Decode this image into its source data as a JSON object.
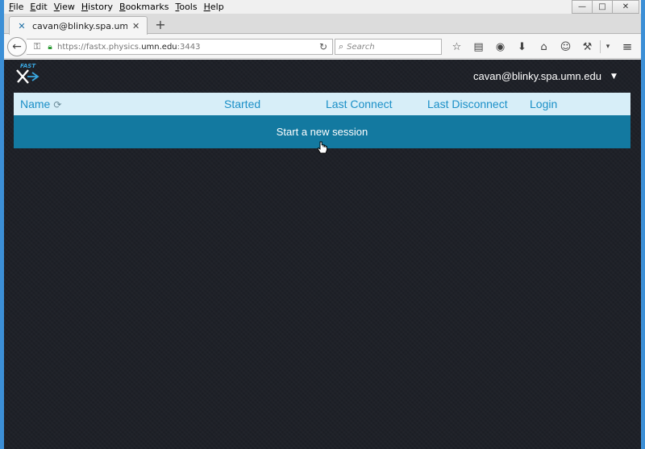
{
  "menubar": {
    "items": [
      {
        "label": "File",
        "key": "F",
        "rest": "ile"
      },
      {
        "label": "Edit",
        "key": "E",
        "rest": "dit"
      },
      {
        "label": "View",
        "key": "V",
        "rest": "iew"
      },
      {
        "label": "History",
        "key": "H",
        "rest": "istory"
      },
      {
        "label": "Bookmarks",
        "key": "B",
        "rest": "ookmarks"
      },
      {
        "label": "Tools",
        "key": "T",
        "rest": "ools"
      },
      {
        "label": "Help",
        "key": "H",
        "rest": "elp"
      }
    ]
  },
  "window_controls": {
    "minimize": "—",
    "maximize": "□",
    "close": "✕"
  },
  "tab": {
    "title": "cavan@blinky.spa.umn.ed...",
    "close": "✕",
    "new_tab": "+"
  },
  "nav": {
    "back": "←",
    "url_prefix": "https://fastx.physics.",
    "url_host": "umn.edu",
    "url_suffix": ":3443",
    "reload": "↻",
    "search_placeholder": "Search"
  },
  "toolbar_icons": [
    {
      "name": "bookmark-star-icon",
      "glyph": "☆"
    },
    {
      "name": "reading-list-icon",
      "glyph": "▤"
    },
    {
      "name": "pocket-icon",
      "glyph": "◉"
    },
    {
      "name": "download-icon",
      "glyph": "⬇"
    },
    {
      "name": "home-icon",
      "glyph": "⌂"
    },
    {
      "name": "chat-icon",
      "glyph": "☺"
    },
    {
      "name": "extension-icon",
      "glyph": "⚒"
    },
    {
      "name": "overflow-caret-icon",
      "glyph": "▾"
    }
  ],
  "hamburger": "≡",
  "app": {
    "user": "cavan@blinky.spa.umn.edu",
    "user_caret": "▼",
    "logo_text": "FAST",
    "columns": [
      "Name",
      "Started",
      "Last Connect",
      "Last Disconnect",
      "Login"
    ],
    "refresh_glyph": "⟳",
    "new_session_label": "Start a new session"
  },
  "colors": {
    "header_bg": "#d7eef8",
    "header_text": "#1a8fc7",
    "new_session_bg": "#1379a0",
    "page_bg": "#1e2128",
    "window_frame": "#3c8fd6"
  }
}
